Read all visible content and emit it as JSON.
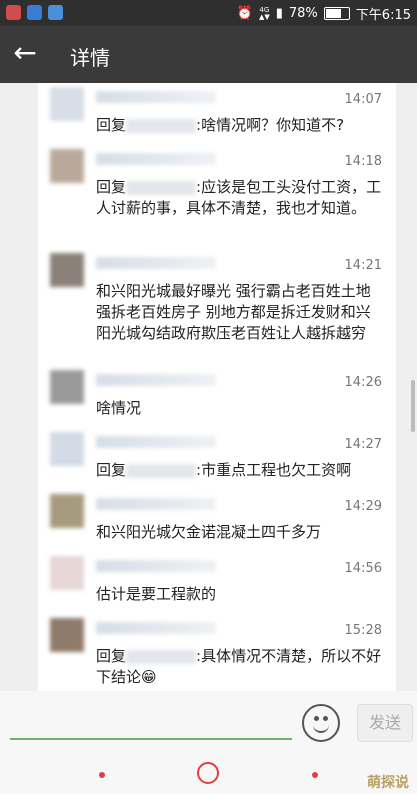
{
  "status": {
    "battery": "78%",
    "time": "下午6:15",
    "network": "4G",
    "battery_fill": 0.78
  },
  "header": {
    "title": "详情"
  },
  "messages": [
    {
      "time": "14:07",
      "before": "回复",
      "after": ":啥情况啊？你知道不?"
    },
    {
      "time": "14:18",
      "before": "回复",
      "after": ":应该是包工头没付工资，工人讨薪的事，具体不清楚，我也才知道。"
    },
    {
      "time": "14:21",
      "before": "",
      "after": "和兴阳光城最好曝光 强行霸占老百姓土地强拆老百姓房子 别地方都是拆迁发财和兴阳光城勾结政府欺压老百姓让人越拆越穷"
    },
    {
      "time": "14:26",
      "before": "",
      "after": "啥情况"
    },
    {
      "time": "14:27",
      "before": "回复",
      "after": ":市重点工程也欠工资啊"
    },
    {
      "time": "14:29",
      "before": "",
      "after": "和兴阳光城欠金诺混凝土四千多万"
    },
    {
      "time": "14:56",
      "before": "",
      "after": "估计是要工程款的"
    },
    {
      "time": "15:28",
      "before": "回复",
      "after": ":具体情况不清楚，所以不好下结论😁"
    }
  ],
  "composer": {
    "send_label": "发送",
    "input_value": ""
  },
  "watermark": {
    "text": "萌探说"
  }
}
